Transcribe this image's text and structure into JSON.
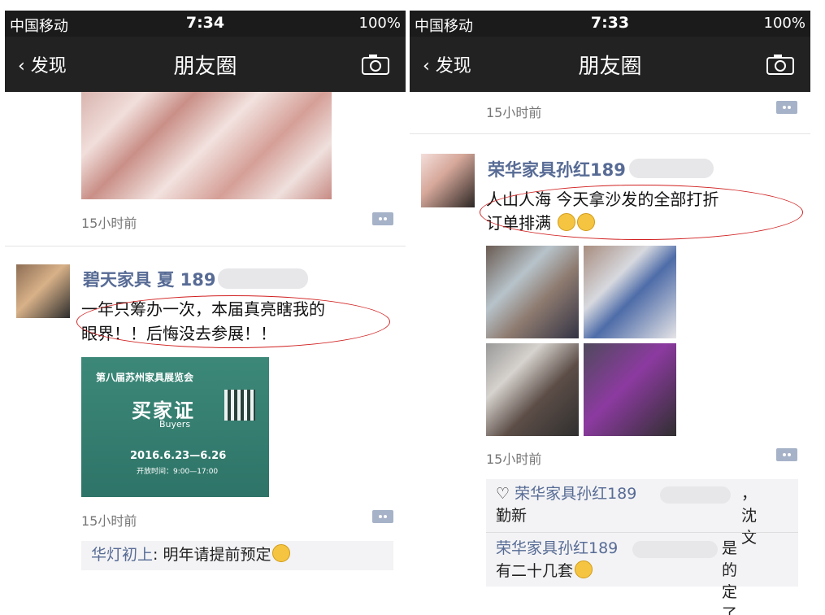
{
  "status": {
    "carrier": "中国移动",
    "battery": "100%",
    "left_time": "7:34",
    "right_time": "7:33"
  },
  "nav": {
    "back": "发现",
    "title": "朋友圈"
  },
  "left": {
    "post_top": {
      "time": "15小时前"
    },
    "post_main": {
      "name": "碧天家具 夏 189",
      "text_line1": "一年只筹办一次，本届真亮瞎我的",
      "text_line2": "眼界！！后悔没去参展！！",
      "photo_title": "第八届苏州家具展览会",
      "photo_big": "买家证",
      "photo_sub": "Buyers",
      "photo_date": "2016.6.23—6.26",
      "photo_hours": "开放时间：9:00—17:00",
      "time": "15小时前",
      "comment_author": "华灯初上",
      "comment_text": "明年请提前预定"
    }
  },
  "right": {
    "post_top": {
      "time": "15小时前"
    },
    "post_main": {
      "name": "荣华家具孙红189",
      "text_line1": "人山人海 今天拿沙发的全部打折",
      "text_line2": "订单排满",
      "time": "15小时前",
      "like_names": "荣华家具孙红189",
      "like_suffix": "，沈文",
      "like_suffix2": "勤新",
      "comment_author": "荣华家具孙红189",
      "comment_text1": "是的 定了",
      "comment_text2": "有二十几套"
    }
  }
}
